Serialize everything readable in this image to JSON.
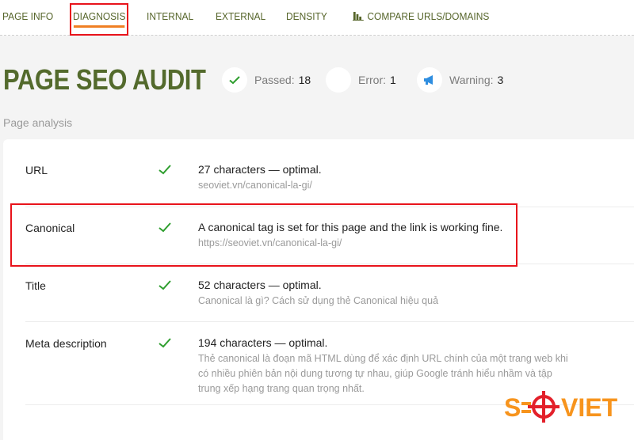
{
  "tabs": [
    {
      "label": "PAGE INFO",
      "active": false
    },
    {
      "label": "DIAGNOSIS",
      "active": true
    },
    {
      "label": "INTERNAL",
      "active": false
    },
    {
      "label": "EXTERNAL",
      "active": false
    },
    {
      "label": "DENSITY",
      "active": false
    },
    {
      "label": "COMPARE URLS/DOMAINS",
      "active": false,
      "icon": "bar-chart-icon"
    }
  ],
  "header": {
    "title": "PAGE SEO AUDIT",
    "stats": [
      {
        "label": "Passed:",
        "value": "18",
        "icon": "check-icon",
        "color": "#2e9e2e"
      },
      {
        "label": "Error:",
        "value": "1",
        "icon": "error-icon",
        "color": "#ffffff"
      },
      {
        "label": "Warning:",
        "value": "3",
        "icon": "megaphone-icon",
        "color": "#2f8ee0"
      }
    ]
  },
  "section": {
    "label": "Page analysis"
  },
  "rows": [
    {
      "name": "URL",
      "status": "passed",
      "main": "27 characters — optimal.",
      "sub": "seoviet.vn/canonical-la-gi/"
    },
    {
      "name": "Canonical",
      "status": "passed",
      "main": "A canonical tag is set for this page and the link is working fine.",
      "sub": "https://seoviet.vn/canonical-la-gi/",
      "highlighted": true
    },
    {
      "name": "Title",
      "status": "passed",
      "main": "52 characters — optimal.",
      "sub": "Canonical là gì? Cách sử dụng thẻ Canonical hiệu quả"
    },
    {
      "name": "Meta description",
      "status": "passed",
      "main": "194 characters — optimal.",
      "sub": "Thẻ canonical là đoạn mã HTML dùng để xác định URL chính của một trang web khi có nhiều phiên bản nội dung tương tự nhau, giúp Google tránh hiểu nhầm và tập trung xếp hạng trang quan trọng nhất."
    }
  ],
  "watermark": {
    "text_left": "S",
    "text_right": "VIET",
    "brand_color": "#f7941d",
    "target_color": "#e3202a"
  },
  "colors": {
    "accent": "#f07f23",
    "title": "#536a2c",
    "highlight": "#e8131b",
    "check": "#2e9e2e"
  }
}
